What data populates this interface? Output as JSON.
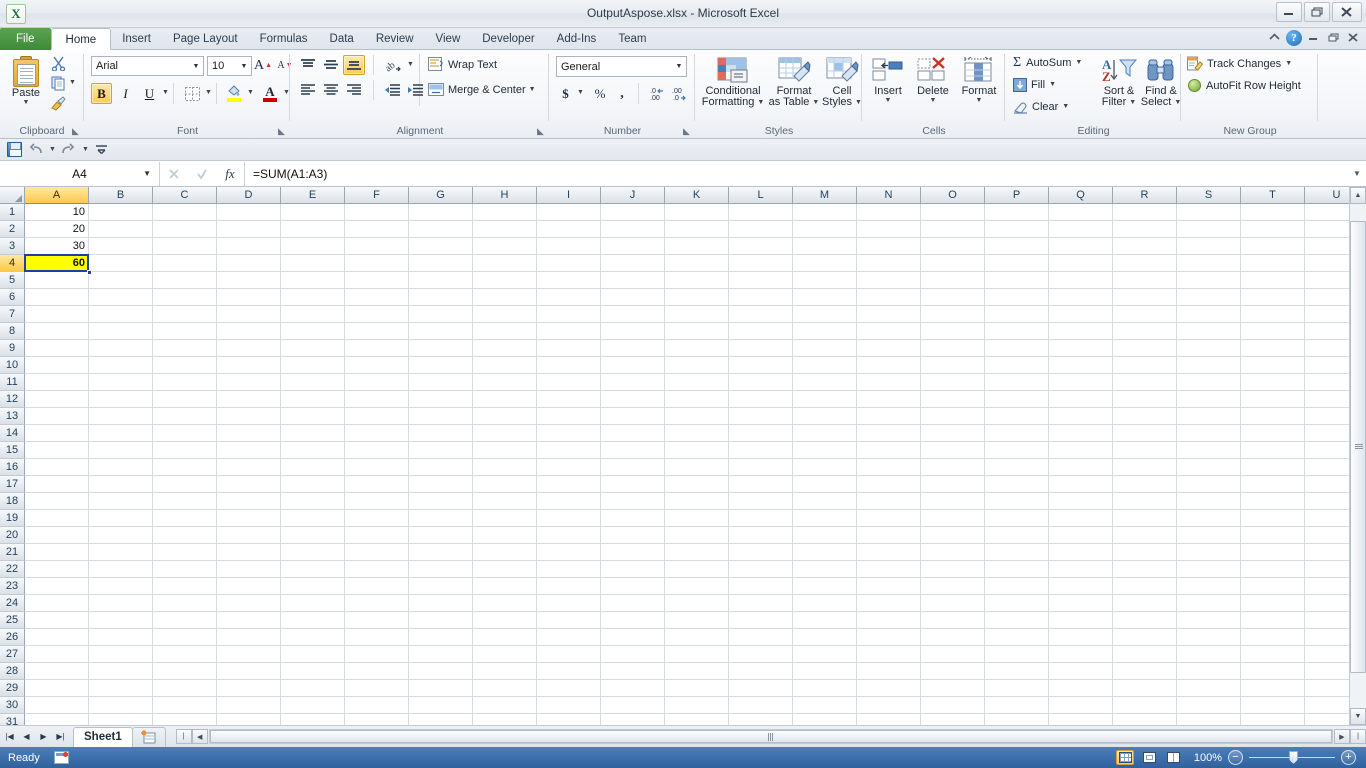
{
  "window": {
    "title": "OutputAspose.xlsx  -  Microsoft Excel",
    "app_icon": "X",
    "minimize": "minimize-icon",
    "restore": "restore-icon",
    "close": "close-icon",
    "help": "?"
  },
  "tabs": [
    {
      "label": "File",
      "id": "file"
    },
    {
      "label": "Home",
      "id": "home"
    },
    {
      "label": "Insert",
      "id": "insert"
    },
    {
      "label": "Page Layout",
      "id": "page-layout"
    },
    {
      "label": "Formulas",
      "id": "formulas"
    },
    {
      "label": "Data",
      "id": "data"
    },
    {
      "label": "Review",
      "id": "review"
    },
    {
      "label": "View",
      "id": "view"
    },
    {
      "label": "Developer",
      "id": "developer"
    },
    {
      "label": "Add-Ins",
      "id": "add-ins"
    },
    {
      "label": "Team",
      "id": "team"
    }
  ],
  "active_tab": "Home",
  "ribbon": {
    "clipboard": {
      "group_label": "Clipboard",
      "paste_label": "Paste",
      "cut_label": "Cut",
      "copy_label": "Copy",
      "format_painter_label": "Format Painter"
    },
    "font": {
      "group_label": "Font",
      "font_name": "Arial",
      "font_size": "10",
      "grow_font": "A",
      "shrink_font": "A",
      "bold": "B",
      "italic": "I",
      "underline": "U",
      "borders_label": "Borders",
      "fill_color_label": "Fill Color",
      "font_color_label": "Font Color",
      "bold_active": true
    },
    "alignment": {
      "group_label": "Alignment",
      "wrap_text": "Wrap Text",
      "merge_center": "Merge & Center",
      "orientation_label": "Orientation",
      "decrease_indent": "Decrease Indent",
      "increase_indent": "Increase Indent",
      "align_bottom_active": true
    },
    "number": {
      "group_label": "Number",
      "format": "General",
      "currency": "$",
      "percent": "%",
      "comma": ",",
      "increase_decimal": ".00",
      "decrease_decimal": ".00"
    },
    "styles": {
      "group_label": "Styles",
      "conditional_formatting": "Conditional\nFormatting",
      "conditional_formatting_l1": "Conditional",
      "conditional_formatting_l2": "Formatting",
      "format_as_table_l1": "Format",
      "format_as_table_l2": "as Table",
      "cell_styles_l1": "Cell",
      "cell_styles_l2": "Styles"
    },
    "cells": {
      "group_label": "Cells",
      "insert": "Insert",
      "delete": "Delete",
      "format": "Format"
    },
    "editing": {
      "group_label": "Editing",
      "autosum": "AutoSum",
      "fill": "Fill",
      "clear": "Clear",
      "sort_filter_l1": "Sort &",
      "sort_filter_l2": "Filter",
      "find_select_l1": "Find &",
      "find_select_l2": "Select"
    },
    "new_group": {
      "group_label": "New Group",
      "track_changes": "Track Changes",
      "autofit_row_height": "AutoFit Row Height"
    }
  },
  "quick_access": {
    "save": "save-icon",
    "undo": "undo-icon",
    "redo": "redo-icon",
    "customize": "customize-icon"
  },
  "formula_bar": {
    "name_box": "A4",
    "fx_label": "fx",
    "formula": "=SUM(A1:A3)"
  },
  "grid": {
    "columns": [
      "A",
      "B",
      "C",
      "D",
      "E",
      "F",
      "G",
      "H",
      "I",
      "J",
      "K",
      "L",
      "M",
      "N",
      "O",
      "P",
      "Q",
      "R",
      "S",
      "T",
      "U"
    ],
    "rows": [
      1,
      2,
      3,
      4,
      5,
      6,
      7,
      8,
      9,
      10,
      11,
      12,
      13,
      14,
      15,
      16,
      17,
      18,
      19,
      20,
      21,
      22,
      23,
      24,
      25,
      26,
      27,
      28,
      29,
      30,
      31
    ],
    "selected_cell": "A4",
    "selected_column": "A",
    "selected_row": 4,
    "values": {
      "A1": "10",
      "A2": "20",
      "A3": "30",
      "A4": "60"
    },
    "highlight_color": "#ffff00"
  },
  "sheet_tabs": {
    "sheets": [
      "Sheet1"
    ],
    "active": "Sheet1",
    "insert_sheet_label": "insert-worksheet"
  },
  "status_bar": {
    "status": "Ready",
    "macro_record_label": "record-macro",
    "zoom": "100%",
    "view_normal": "normal-view",
    "view_page_layout": "page-layout-view",
    "view_page_break": "page-break-preview",
    "zoom_out": "−",
    "zoom_in": "+"
  }
}
